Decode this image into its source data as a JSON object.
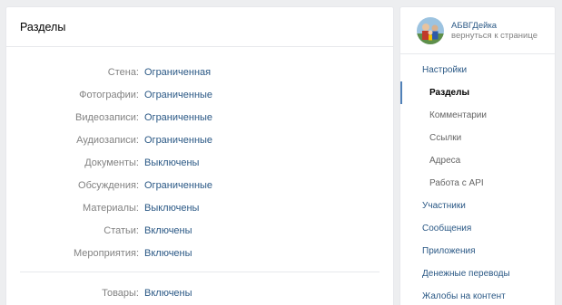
{
  "main": {
    "title": "Разделы",
    "rows": [
      {
        "label": "Стена:",
        "value": "Ограниченная"
      },
      {
        "label": "Фотографии:",
        "value": "Ограниченные"
      },
      {
        "label": "Видеозаписи:",
        "value": "Ограниченные"
      },
      {
        "label": "Аудиозаписи:",
        "value": "Ограниченные"
      },
      {
        "label": "Документы:",
        "value": "Выключены"
      },
      {
        "label": "Обсуждения:",
        "value": "Ограниченные"
      },
      {
        "label": "Материалы:",
        "value": "Выключены"
      },
      {
        "label": "Статьи:",
        "value": "Включены"
      },
      {
        "label": "Мероприятия:",
        "value": "Включены"
      }
    ],
    "rows_after_divider": [
      {
        "label": "Товары:",
        "value": "Включены"
      }
    ]
  },
  "side": {
    "group_name": "АБВГДейка",
    "back_link": "вернуться к странице",
    "menu": [
      {
        "label": "Настройки"
      },
      {
        "label": "Разделы"
      },
      {
        "label": "Комментарии"
      },
      {
        "label": "Ссылки"
      },
      {
        "label": "Адреса"
      },
      {
        "label": "Работа с API"
      },
      {
        "label": "Участники"
      },
      {
        "label": "Сообщения"
      },
      {
        "label": "Приложения"
      },
      {
        "label": "Денежные переводы"
      },
      {
        "label": "Жалобы на контент"
      }
    ]
  },
  "colors": {
    "background": "#edeef0",
    "link": "#2a5885",
    "label": "#828282",
    "accent": "#5181b8"
  },
  "icons": {
    "avatar": "group-avatar-icon"
  }
}
